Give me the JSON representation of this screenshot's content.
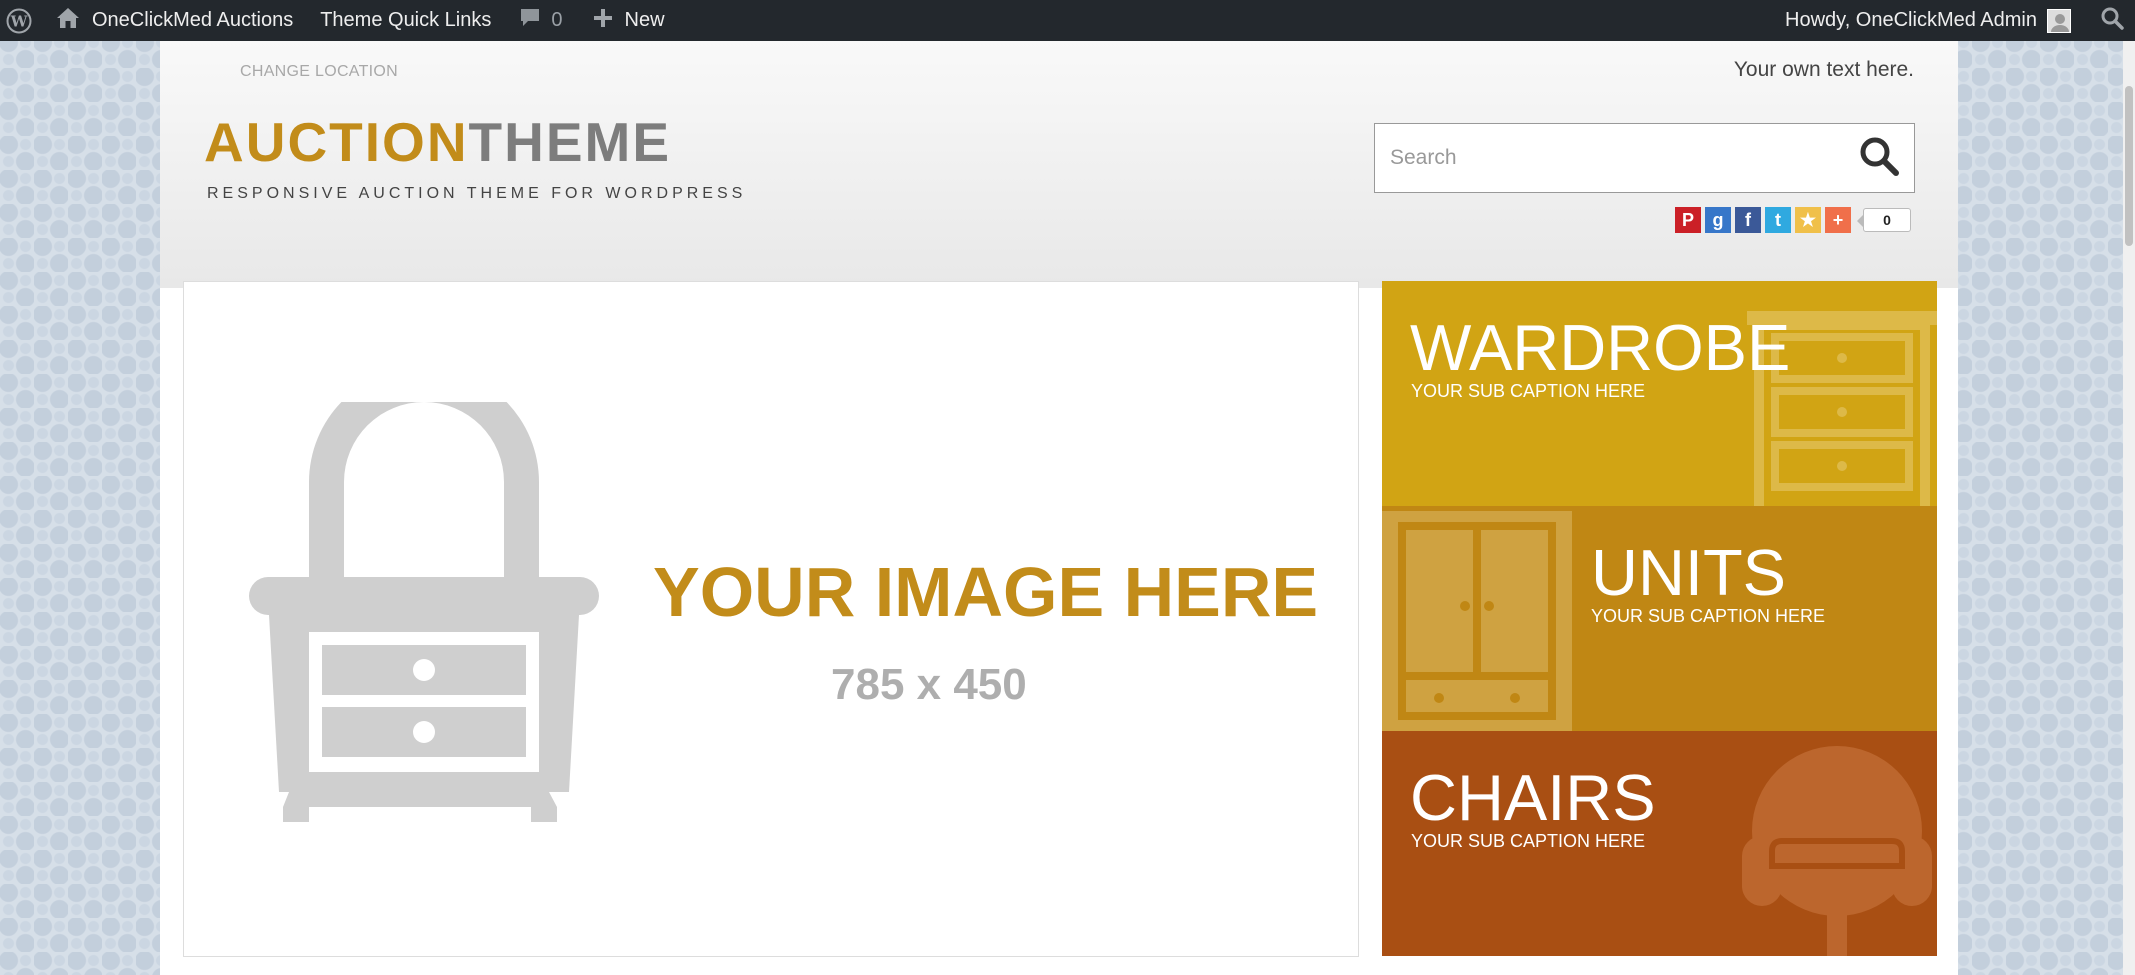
{
  "admin_bar": {
    "site_name": "OneClickMed Auctions",
    "quick_links": "Theme Quick Links",
    "comments_count": "0",
    "new_label": "New",
    "howdy": "Howdy, OneClickMed Admin"
  },
  "header": {
    "change_location": "CHANGE LOCATION",
    "own_text": "Your own text here.",
    "logo_part1": "AUCTION",
    "logo_part2": "THEME",
    "tagline": "RESPONSIVE AUCTION THEME FOR WORDPRESS",
    "search_placeholder": "Search",
    "share_icons": [
      "pinterest-icon",
      "google-plus-icon",
      "facebook-icon",
      "twitter-icon",
      "favorites-icon",
      "addthis-icon"
    ],
    "share_count": "0"
  },
  "banner": {
    "headline": "YOUR IMAGE HERE",
    "size": "785 x 450"
  },
  "tiles": [
    {
      "title": "WARDROBE",
      "subtitle": "YOUR SUB CAPTION HERE",
      "color": "#d1a414"
    },
    {
      "title": "UNITS",
      "subtitle": "YOUR SUB CAPTION HERE",
      "color": "#c08714"
    },
    {
      "title": "CHAIRS",
      "subtitle": "YOUR SUB CAPTION HERE",
      "color": "#a94f13"
    }
  ],
  "colors": {
    "admin_bar": "#23282d",
    "brand_gold": "#c28c1a",
    "logo_grey": "#7d7d7d"
  }
}
